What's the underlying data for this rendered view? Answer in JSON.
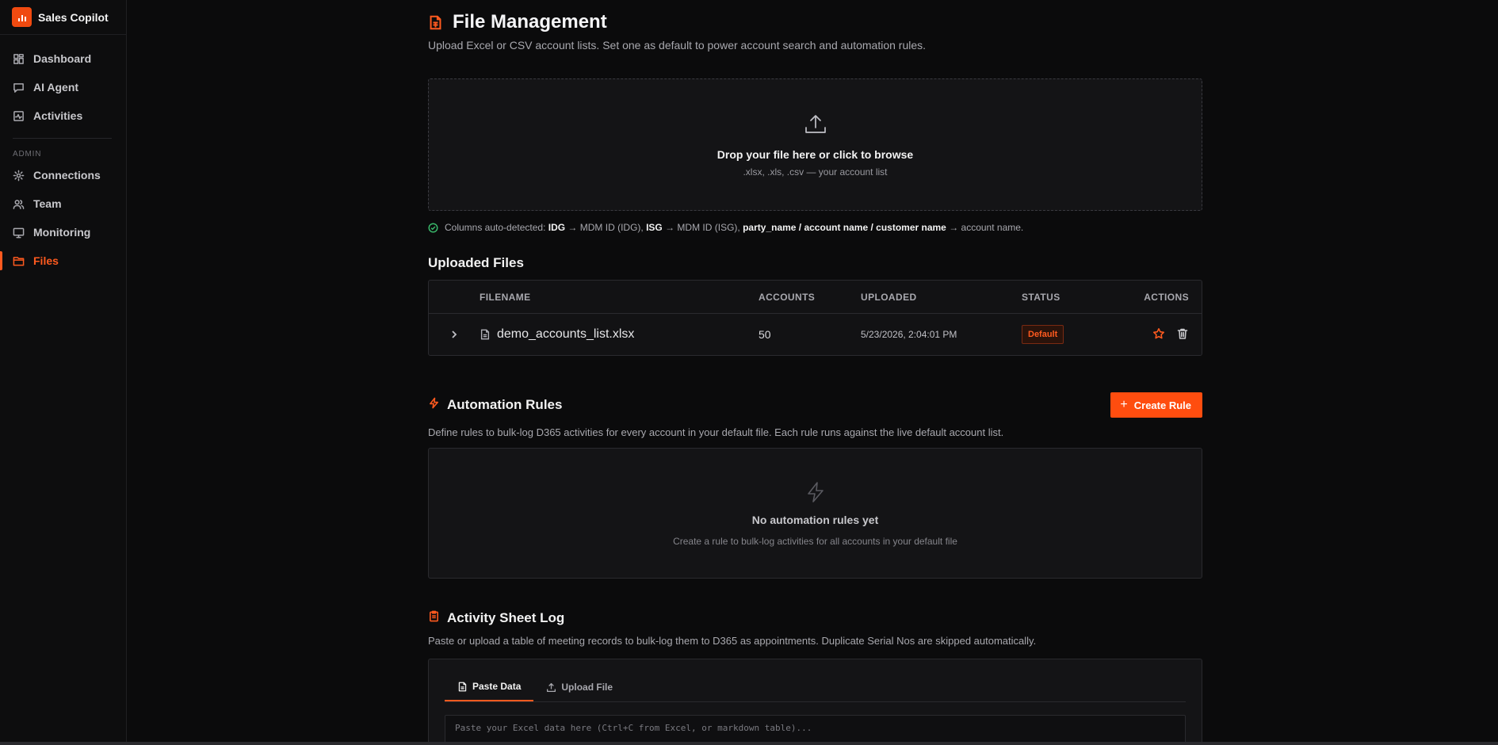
{
  "app": {
    "name": "Sales Copilot"
  },
  "sidebar": {
    "items": [
      {
        "label": "Dashboard",
        "icon": "dashboard-icon"
      },
      {
        "label": "AI Agent",
        "icon": "chat-icon"
      },
      {
        "label": "Activities",
        "icon": "activity-icon"
      }
    ],
    "admin_label": "ADMIN",
    "admin_items": [
      {
        "label": "Connections",
        "icon": "gear-icon"
      },
      {
        "label": "Team",
        "icon": "users-icon"
      },
      {
        "label": "Monitoring",
        "icon": "monitor-icon"
      },
      {
        "label": "Files",
        "icon": "folder-icon",
        "active": true
      }
    ]
  },
  "page": {
    "title": "File Management",
    "subtitle": "Upload Excel or CSV account lists. Set one as default to power account search and automation rules."
  },
  "dropzone": {
    "title": "Drop your file here or click to browse",
    "subtitle": ".xlsx, .xls, .csv — your account list"
  },
  "detected": {
    "prefix": "Columns auto-detected:",
    "idg": "IDG",
    "idg_map": " → MDM ID (IDG), ",
    "isg": "ISG",
    "isg_map": " → MDM ID (ISG), ",
    "name_cols": "party_name / account name / customer name",
    "name_map": " → account name."
  },
  "uploaded": {
    "title": "Uploaded Files",
    "columns": {
      "filename": "FILENAME",
      "accounts": "ACCOUNTS",
      "uploaded": "UPLOADED",
      "status": "STATUS",
      "actions": "ACTIONS"
    },
    "rows": [
      {
        "filename": "demo_accounts_list.xlsx",
        "accounts": "50",
        "uploaded": "5/23/2026, 2:04:01 PM",
        "status": "Default"
      }
    ]
  },
  "rules": {
    "title": "Automation Rules",
    "create_label": "Create Rule",
    "description": "Define rules to bulk-log D365 activities for every account in your default file. Each rule runs against the live default account list.",
    "empty_title": "No automation rules yet",
    "empty_subtitle": "Create a rule to bulk-log activities for all accounts in your default file"
  },
  "sheet": {
    "title": "Activity Sheet Log",
    "description": "Paste or upload a table of meeting records to bulk-log them to D365 as appointments. Duplicate Serial Nos are skipped automatically.",
    "tabs": [
      {
        "label": "Paste Data"
      },
      {
        "label": "Upload File"
      }
    ],
    "placeholder": "Paste your Excel data here (Ctrl+C from Excel, or markdown table)..."
  },
  "colors": {
    "accent": "#ff5a1f",
    "success": "#39b86a",
    "background": "#0b0b0c"
  }
}
